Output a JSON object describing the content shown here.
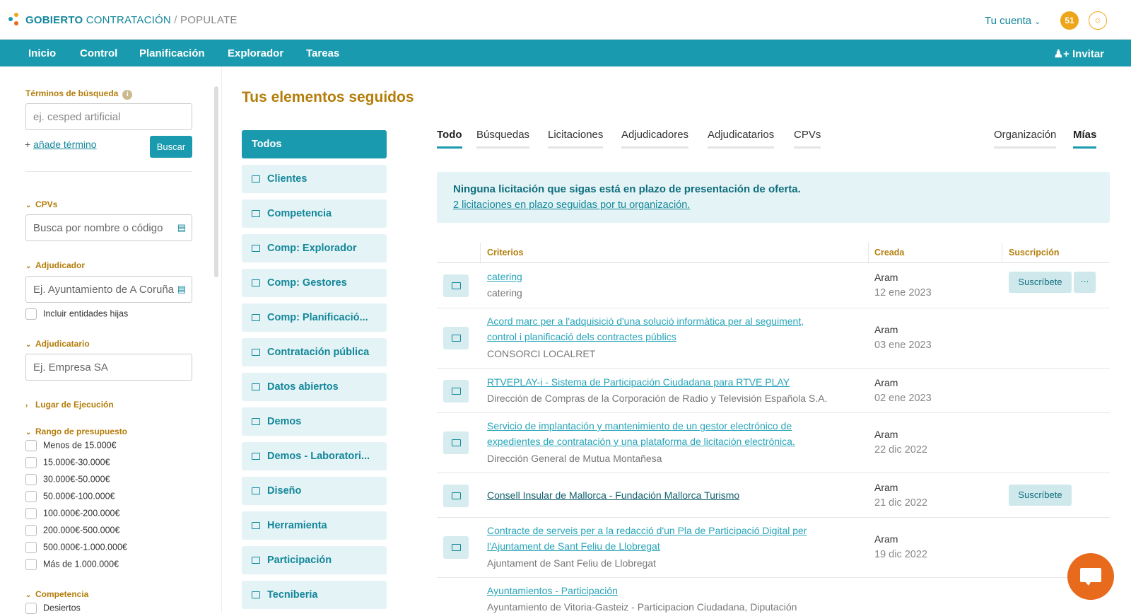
{
  "header": {
    "brand_bold": "GOBIERTO",
    "brand_mid": "CONTRATACIÓN",
    "brand_sep": "/",
    "brand_tail": "POPULATE",
    "account": "Tu cuenta",
    "notif_count": "51"
  },
  "nav": {
    "items": [
      "Inicio",
      "Control",
      "Planificación",
      "Explorador",
      "Tareas"
    ],
    "invite": "Invitar"
  },
  "sidebar": {
    "search_label": "Términos de búsqueda",
    "search_placeholder": "ej. cesped artificial",
    "add_term_prefix": "+ ",
    "add_term": "añade término",
    "search_button": "Buscar",
    "cpvs_label": "CPVs",
    "cpvs_placeholder": "Busca por nombre o código",
    "adjudicador_label": "Adjudicador",
    "adjudicador_placeholder": "Ej. Ayuntamiento de A Coruña",
    "include_children": "Incluir entidades hijas",
    "adjudicatario_label": "Adjudicatario",
    "adjudicatario_placeholder": "Ej. Empresa SA",
    "lugar_label": "Lugar de Ejecución",
    "rango_label": "Rango de presupuesto",
    "rangos": [
      "Menos de 15.000€",
      "15.000€-30.000€",
      "30.000€-50.000€",
      "50.000€-100.000€",
      "100.000€-200.000€",
      "200.000€-500.000€",
      "500.000€-1.000.000€",
      "Más de 1.000.000€"
    ],
    "competencia_label": "Competencia",
    "competencia_items": [
      "Desiertos"
    ]
  },
  "main": {
    "title": "Tus elementos seguidos",
    "folders": [
      "Todos",
      "Clientes",
      "Competencia",
      "Comp: Explorador",
      "Comp: Gestores",
      "Comp: Planificació...",
      "Contratación pública",
      "Datos abiertos",
      "Demos",
      "Demos - Laboratori...",
      "Diseño",
      "Herramienta",
      "Participación",
      "Tecniberia"
    ],
    "tabs": [
      "Todo",
      "Búsquedas",
      "Licitaciones",
      "Adjudicadores",
      "Adjudicatarios",
      "CPVs"
    ],
    "tabs_right": [
      "Organización",
      "Mías"
    ],
    "alert_title": "Ninguna licitación que sigas está en plazo de presentación de oferta.",
    "alert_link": "2 licitaciones en plazo seguidas por tu organización.",
    "columns": [
      "Criterios",
      "Creada",
      "Suscripción"
    ],
    "subscribe_label": "Suscríbete",
    "more_label": "···",
    "rows": [
      {
        "name": "catering",
        "sub": "catering",
        "user": "Aram",
        "date": "12 ene 2023"
      },
      {
        "name": "Acord marc per a l'adquisició d'una solució informàtica per al seguiment, control i planificació dels contractes públics",
        "sub": "CONSORCI LOCALRET",
        "user": "Aram",
        "date": "03 ene 2023"
      },
      {
        "name": "RTVEPLAY-i - Sistema de Participación Ciudadana para RTVE PLAY",
        "sub": "Dirección de Compras de la Corporación de Radio y Televisión Española S.A.",
        "user": "Aram",
        "date": "02 ene 2023"
      },
      {
        "name": "Servicio de implantación y mantenimiento de un gestor electrónico de expedientes de contratación y una plataforma de licitación electrónica.",
        "sub": "Dirección General de Mutua Montañesa",
        "user": "Aram",
        "date": "22 dic 2022"
      },
      {
        "name": "Consell Insular de Mallorca - Fundación Mallorca Turismo",
        "sub": "",
        "user": "Aram",
        "date": "21 dic 2022"
      },
      {
        "name": "Contracte de serveis per a la redacció d'un Pla de Participació Digital per l'Ajuntament de Sant Feliu de Llobregat",
        "sub": "Ajuntament de Sant Feliu de Llobregat",
        "user": "Aram",
        "date": "19 dic 2022"
      },
      {
        "name": "Ayuntamientos - Participación",
        "sub": "Ayuntamiento de Vitoria-Gasteiz - Participacion Ciudadana, Diputación",
        "user": "",
        "date": ""
      }
    ]
  },
  "colors": {
    "accent": "#1a9aae",
    "gold": "#b47d0a",
    "orange": "#e86a1c"
  }
}
